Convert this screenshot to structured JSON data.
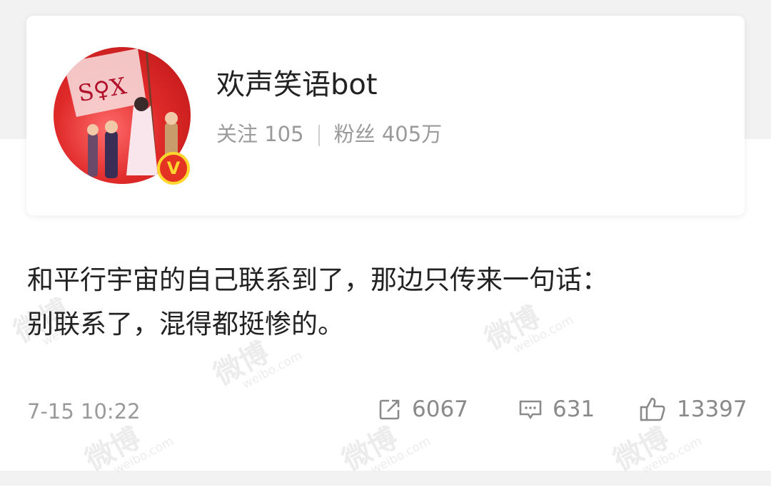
{
  "profile": {
    "username": "欢声笑语bot",
    "following_label": "关注",
    "following_count": "105",
    "followers_label": "粉丝",
    "followers_count": "405万",
    "verified_mark": "V",
    "flag_text": "S♀X"
  },
  "post": {
    "line1": "和平行宇宙的自己联系到了，那边只传来一句话：",
    "line2": "别联系了，混得都挺惨的。",
    "timestamp": "7-15 10:22"
  },
  "actions": {
    "repost_count": "6067",
    "comment_count": "631",
    "like_count": "13397"
  },
  "watermark": {
    "brand": "微博",
    "domain": "weibo.com"
  },
  "colors": {
    "avatar_red": "#e02a2a",
    "verified_badge": "#e53323",
    "verified_ring": "#ffd52e",
    "text_primary": "#222222",
    "text_secondary": "#9a9a9a"
  }
}
